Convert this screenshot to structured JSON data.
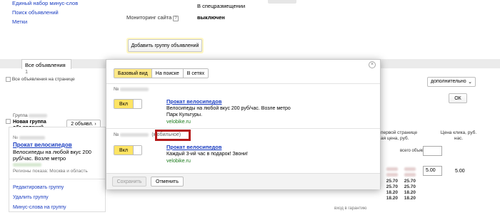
{
  "top": {
    "links": [
      "Единый набор минус-слов",
      "Поиск объявлений",
      "Метки"
    ],
    "placement_text": "В спецразмещении",
    "monitoring_label": "Мониторинг сайта",
    "help_icon": "?",
    "monitoring_value": "выключен",
    "add_group_label": "Добавить группу объявлений"
  },
  "list": {
    "tab_label": "Все объявления",
    "tab_count": "1",
    "all_on_page": "Все объявления на странице",
    "group_label": "Группа",
    "new_group": "Новая группа объявлений",
    "count_btn": "2 объявл. ›",
    "num_prefix": "№",
    "ad_title": "Прокат велосипедов",
    "ad_text": "Велосипеды на любой вкус 200 руб/час. Возле метро",
    "regions": "Регионы показа: Москва и область",
    "links": [
      "Редактировать группу",
      "Удалить группу",
      "Минус-слова на группу"
    ],
    "dropdown": "дополнительно",
    "ok": "ОК",
    "col_head1": "первой странице",
    "col_head1b": "ая цена, руб.",
    "col_head2": "Цена клика, руб.",
    "col_head2b": "нас.",
    "col_head2c": "на",
    "all_ads_label": "всего объявления:",
    "bids_a": [
      "25.70",
      "25.70",
      "18.20",
      "18.20"
    ],
    "bids_b": [
      "25.70",
      "18.20"
    ],
    "bid_value": "5.00",
    "bid_value2": "5.00",
    "bottom_text": "вход в гарантию"
  },
  "modal": {
    "close_icon": "×",
    "tabs": [
      "Базовый вид",
      "На поиске",
      "В сетях"
    ],
    "active_tab": 0,
    "ad1": {
      "num": "№",
      "toggle": "Вкл",
      "title": "Прокат велосипедов",
      "text": "Велосипеды на любой вкус 200 руб/час. Возле метро Парк Культуры.",
      "url": "velobike.ru"
    },
    "ad2": {
      "num": "№",
      "mobile": "(мобильное)",
      "toggle": "Вкл",
      "title": "Прокат велосипедов",
      "text": "Каждый 3-ий час в подарок! Звони!",
      "url": "velobike.ru"
    },
    "save": "Сохранить",
    "cancel": "Отменить"
  }
}
